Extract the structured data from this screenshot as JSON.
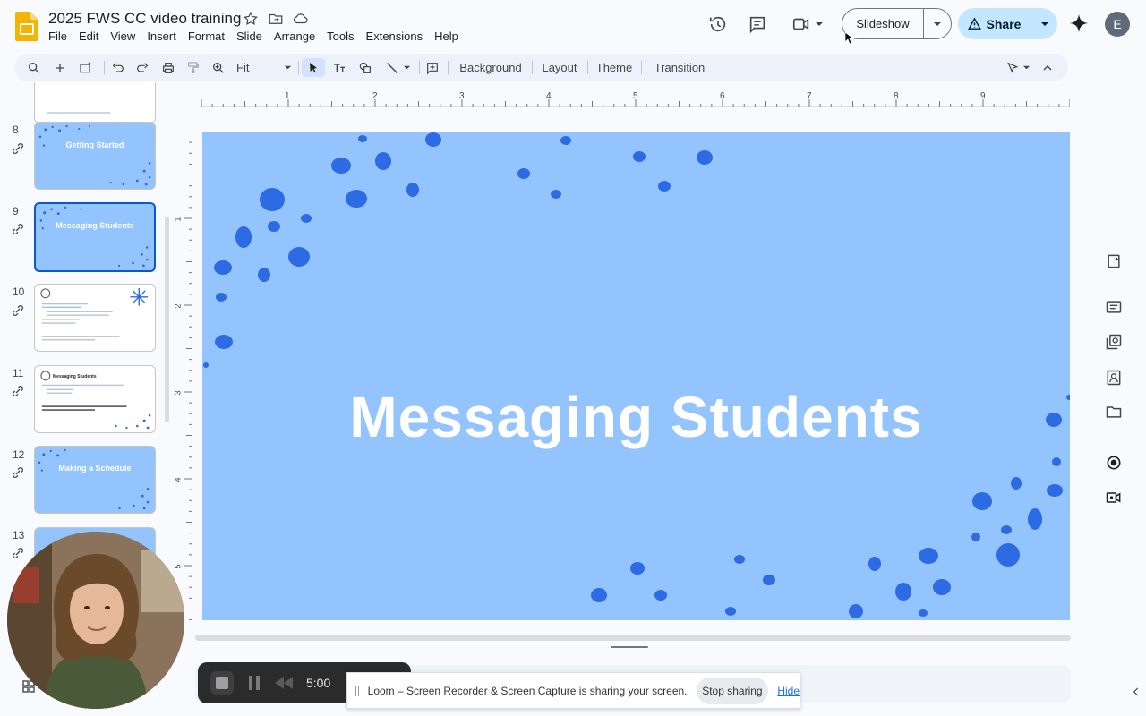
{
  "app": {
    "title": "2025 FWS CC video training",
    "menu": [
      "File",
      "Edit",
      "View",
      "Insert",
      "Format",
      "Slide",
      "Arrange",
      "Tools",
      "Extensions",
      "Help"
    ],
    "user_initial": "E",
    "colors": {
      "accent": "#0b57d0",
      "slide_bg": "#93c4fd",
      "dot": "#2d6be4",
      "share_bg": "#c2e7ff"
    }
  },
  "header": {
    "slideshow_label": "Slideshow",
    "share_label": "Share"
  },
  "toolbar": {
    "zoom_value": "Fit",
    "background_label": "Background",
    "layout_label": "Layout",
    "theme_label": "Theme",
    "transition_label": "Transition"
  },
  "filmstrip": {
    "slides": [
      {
        "number": "8",
        "title": "Getting Started",
        "style": "blue"
      },
      {
        "number": "9",
        "title": "Messaging Students",
        "style": "blue",
        "selected": true
      },
      {
        "number": "10",
        "title": "",
        "style": "white"
      },
      {
        "number": "11",
        "title": "Messaging Students",
        "style": "white"
      },
      {
        "number": "12",
        "title": "Making a Schedule",
        "style": "blue"
      },
      {
        "number": "13",
        "title": "",
        "style": "blue"
      }
    ]
  },
  "slide": {
    "title": "Messaging Students"
  },
  "ruler": {
    "h_labels": [
      "1",
      "2",
      "3",
      "4",
      "5",
      "6",
      "7",
      "8",
      "9"
    ],
    "v_labels": [
      "1",
      "2",
      "3",
      "4",
      "5"
    ]
  },
  "recorder": {
    "timer": "5:00",
    "notice_text": "Loom – Screen Recorder & Screen Capture is sharing your screen.",
    "stop_label": "Stop sharing",
    "hide_label": "Hide"
  }
}
